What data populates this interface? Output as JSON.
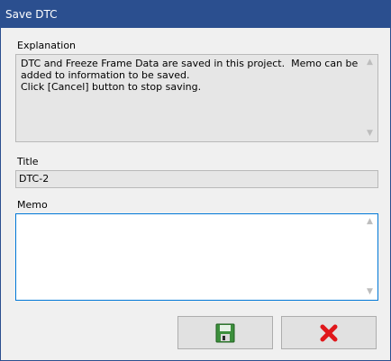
{
  "window": {
    "title": "Save DTC",
    "accent": "#2b4f8f"
  },
  "explanation": {
    "label": "Explanation",
    "text": "DTC and Freeze Frame Data are saved in this project.  Memo can be\nadded to information to be saved.\nClick [Cancel] button to stop saving."
  },
  "title_field": {
    "label": "Title",
    "value": "DTC-2"
  },
  "memo": {
    "label": "Memo",
    "value": ""
  },
  "buttons": {
    "save": {
      "icon": "save-disk-icon"
    },
    "cancel": {
      "icon": "red-x-icon"
    }
  }
}
